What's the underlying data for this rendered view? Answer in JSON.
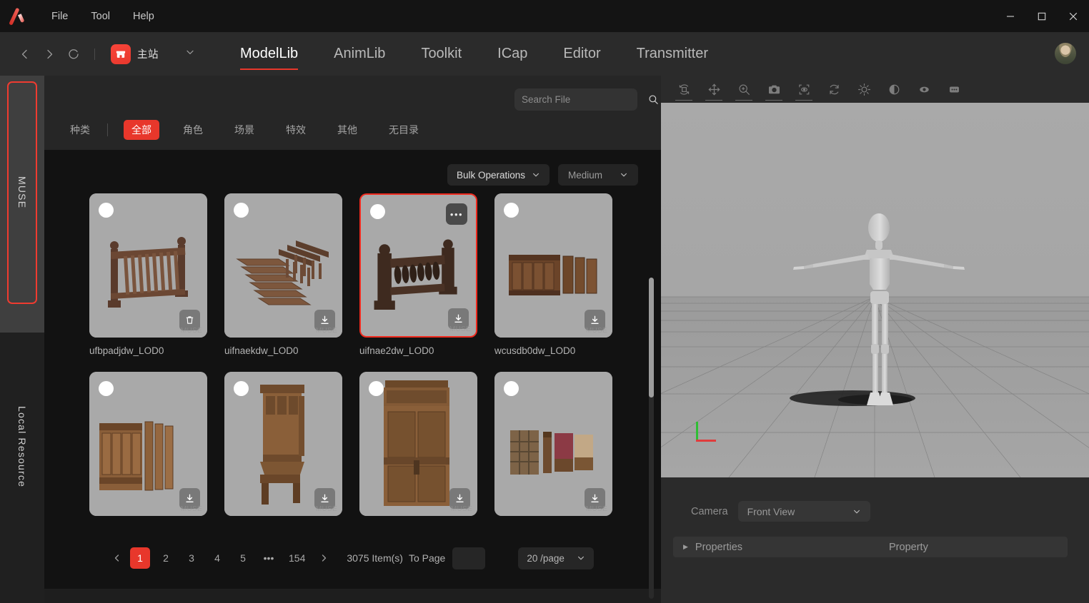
{
  "titlebar": {
    "logo": "app-logo",
    "menus": [
      "File",
      "Tool",
      "Help"
    ],
    "window_controls": {
      "minimize": "–",
      "maximize": "□",
      "close": "✕"
    }
  },
  "navbar": {
    "back": "‹",
    "forward": "›",
    "reload": "⟳",
    "site": {
      "icon": "store-icon",
      "name": "主站",
      "caret": "⌄"
    },
    "tabs": [
      {
        "label": "ModelLib",
        "active": true
      },
      {
        "label": "AnimLib",
        "active": false
      },
      {
        "label": "Toolkit",
        "active": false
      },
      {
        "label": "ICap",
        "active": false
      },
      {
        "label": "Editor",
        "active": false
      },
      {
        "label": "Transmitter",
        "active": false
      }
    ],
    "avatar": "user-avatar"
  },
  "rail": {
    "items": [
      {
        "label": "MUSE",
        "selected": true
      },
      {
        "label": "Local Resource",
        "selected": false
      }
    ]
  },
  "browser": {
    "search": {
      "value": "",
      "placeholder": "Search File"
    },
    "category": {
      "title": "种类",
      "chips": [
        {
          "label": "全部",
          "active": true
        },
        {
          "label": "角色",
          "active": false
        },
        {
          "label": "场景",
          "active": false
        },
        {
          "label": "特效",
          "active": false
        },
        {
          "label": "其他",
          "active": false
        },
        {
          "label": "无目录",
          "active": false
        }
      ]
    },
    "toolbar": {
      "bulk_operations": "Bulk Operations",
      "size": "Medium"
    },
    "items": [
      {
        "name": "ufbpadjdw_LOD0",
        "action": "delete",
        "selected": false,
        "watermark": "MUSE",
        "art": "railing-baluster"
      },
      {
        "name": "uifnaekdw_LOD0",
        "action": "download",
        "selected": false,
        "watermark": "MUSE",
        "art": "stairs"
      },
      {
        "name": "uifnae2dw_LOD0",
        "action": "download",
        "selected": true,
        "watermark": "MUSE",
        "art": "railing-dark"
      },
      {
        "name": "wcusdb0dw_LOD0",
        "action": "download",
        "selected": false,
        "watermark": "MUSE",
        "art": "panel-wall"
      },
      {
        "name": "",
        "action": "download",
        "selected": false,
        "watermark": "MUSE",
        "art": "panel-row"
      },
      {
        "name": "",
        "action": "download",
        "selected": false,
        "watermark": "MUSE",
        "art": "gothic-chair"
      },
      {
        "name": "",
        "action": "download",
        "selected": false,
        "watermark": "MUSE",
        "art": "carved-door"
      },
      {
        "name": "",
        "action": "download",
        "selected": false,
        "watermark": "MUSE",
        "art": "window-set"
      }
    ],
    "pagination": {
      "prev": "‹",
      "next": "›",
      "pages": [
        "1",
        "2",
        "3",
        "4",
        "5"
      ],
      "ellipsis": "•••",
      "last_page": "154",
      "current": "1",
      "total_text": "3075 Item(s)",
      "to_page_label": "To Page",
      "to_page_value": "",
      "per_page": "20 /page"
    }
  },
  "viewport": {
    "toolbar_icons": [
      "orbit-icon",
      "move-icon",
      "zoom-icon",
      "camera-icon",
      "frame-icon",
      "reset-icon",
      "brightness-icon",
      "contrast-icon",
      "visibility-icon",
      "more-icon"
    ],
    "camera": {
      "label": "Camera",
      "value": "Front View"
    },
    "properties": {
      "expander": "▶",
      "label": "Properties",
      "column": "Property"
    },
    "axis": {
      "y": "green-axis",
      "x": "red-axis"
    },
    "model": "humanoid-mannequin"
  },
  "colors": {
    "accent": "#e8372b",
    "selection_border": "#f02a1e",
    "panel_bg": "#121212",
    "nav_bg": "#2b2b2b",
    "title_bg": "#141414",
    "card_bg": "#a9a9a9"
  }
}
